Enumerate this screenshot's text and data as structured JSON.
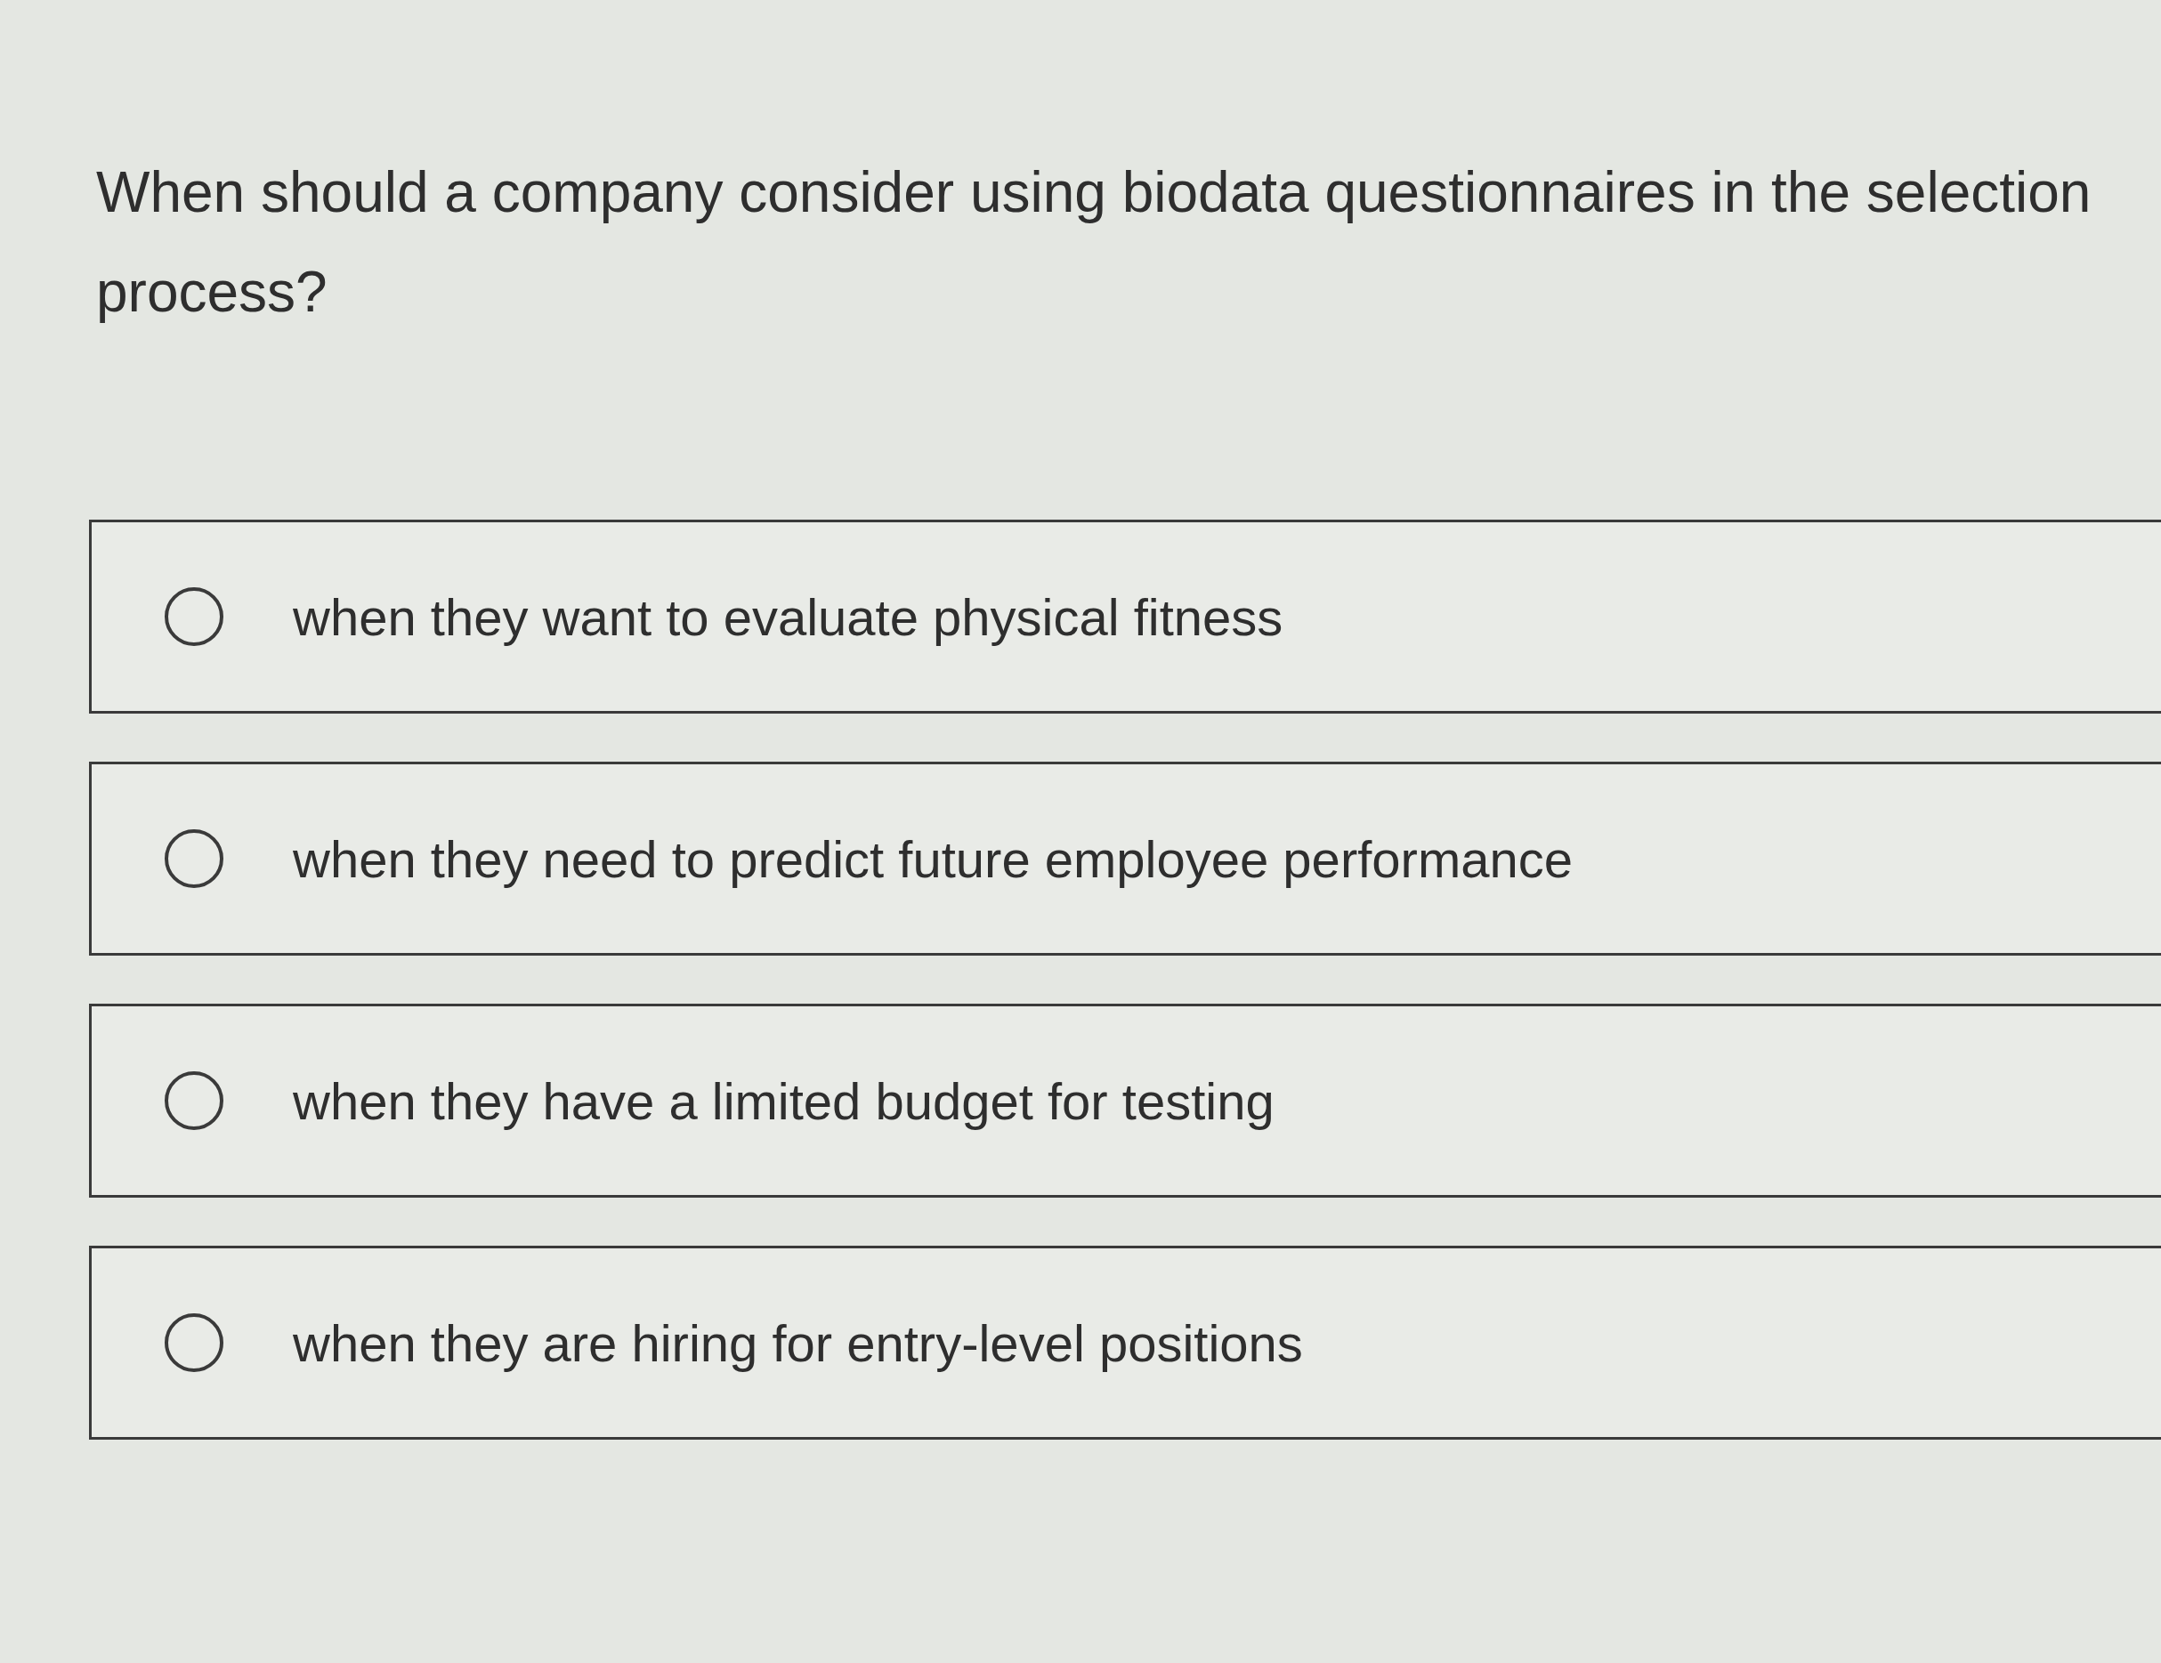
{
  "question": "When should a company consider using biodata questionnaires in the selection process?",
  "options": [
    {
      "label": "when they want to evaluate physical fitness",
      "selected": false
    },
    {
      "label": "when they need to predict future employee performance",
      "selected": false
    },
    {
      "label": "when they have a limited budget for testing",
      "selected": false
    },
    {
      "label": "when they are hiring for entry-level positions",
      "selected": false
    }
  ]
}
